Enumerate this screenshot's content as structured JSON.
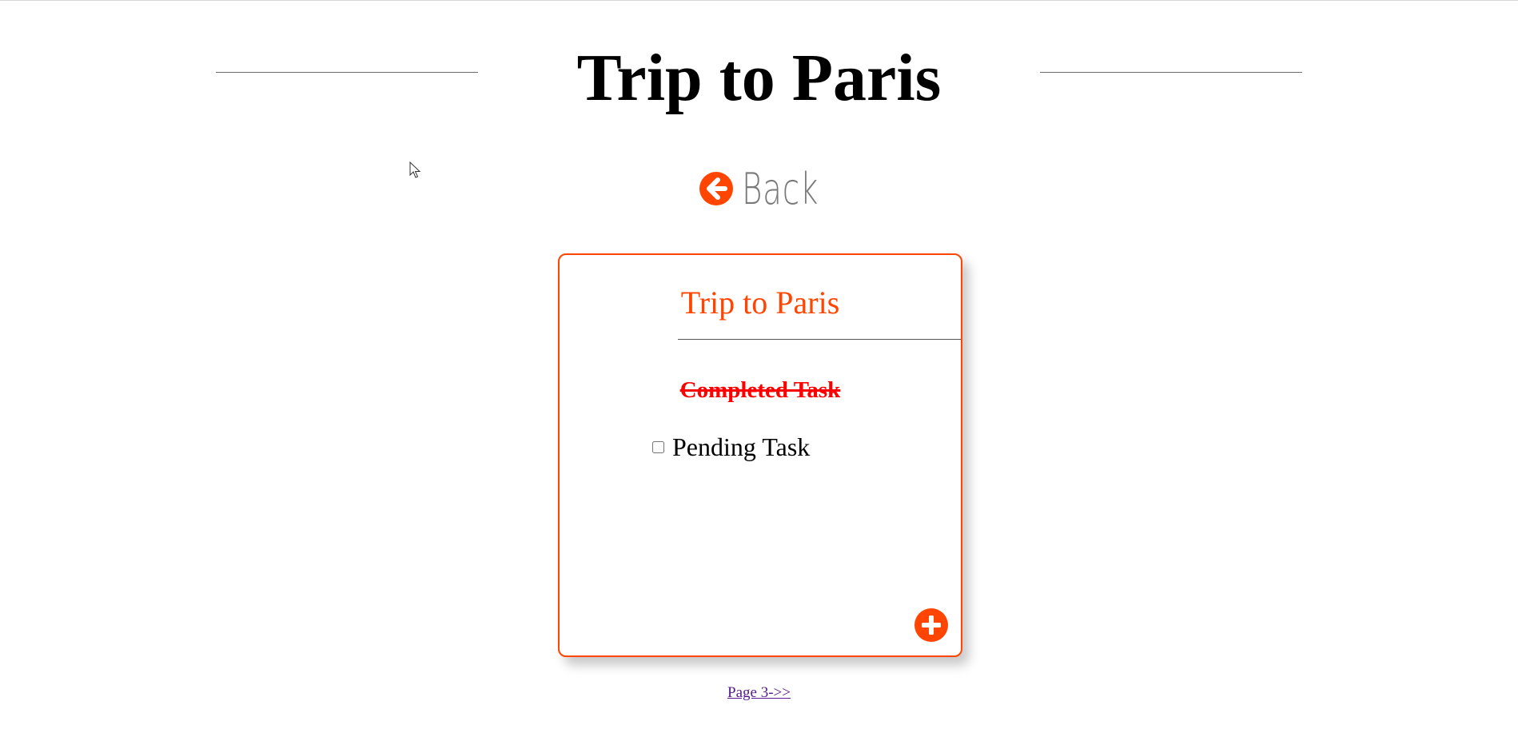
{
  "header": {
    "title": "Trip to Paris"
  },
  "nav": {
    "back_label": "Back",
    "back_icon": "arrow-left-circle-icon"
  },
  "card": {
    "title": "Trip to Paris",
    "tasks": [
      {
        "label": "Completed Task",
        "completed": true
      },
      {
        "label": "Pending Task",
        "completed": false
      }
    ],
    "add_icon": "plus-circle-icon"
  },
  "pagination": {
    "next_label": "Page 3->>"
  },
  "colors": {
    "accent": "#ff4500",
    "completed_text": "#ff0000",
    "back_text": "#7a7a7a",
    "visited_link": "#551a8b"
  }
}
